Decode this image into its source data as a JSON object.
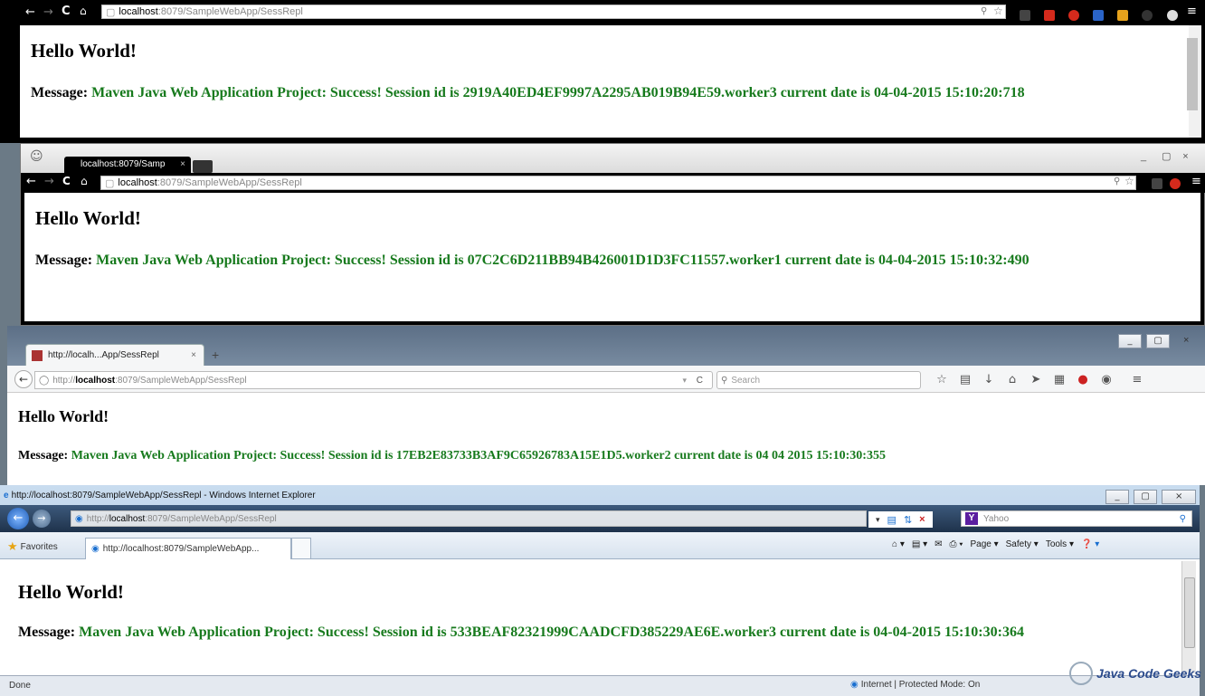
{
  "win1": {
    "url_host": "localhost",
    "url_rest": ":8079/SampleWebApp/SessRepl",
    "heading": "Hello World!",
    "msg_label": "Message:",
    "msg_text": "Maven Java Web Application Project: Success! Session id is 2919A40ED4EF9997A2295AB019B94E59.worker3 current date is 04-04-2015 15:10:20:718"
  },
  "win2": {
    "tab_title": "localhost:8079/Samp",
    "url_host": "localhost",
    "url_rest": ":8079/SampleWebApp/SessRepl",
    "heading": "Hello World!",
    "msg_label": "Message:",
    "msg_text": "Maven Java Web Application Project: Success! Session id is 07C2C6D211BB94B426001D1D3FC11557.worker1 current date is 04-04-2015 15:10:32:490"
  },
  "win3": {
    "tab_title": "http://localh...App/SessRepl",
    "url_prefix": "http://",
    "url_host": "localhost",
    "url_rest": ":8079/SampleWebApp/SessRepl",
    "search_placeholder": "Search",
    "heading": "Hello World!",
    "msg_label": "Message:",
    "msg_text": "Maven Java Web Application Project: Success! Session id is 17EB2E83733B3AF9C65926783A15E1D5.worker2 current date is 04 04 2015 15:10:30:355"
  },
  "win4": {
    "title": "http://localhost:8079/SampleWebApp/SessRepl - Windows Internet Explorer",
    "url_prefix": "http://",
    "url_host": "localhost",
    "url_rest": ":8079/SampleWebApp/SessRepl",
    "search_text": "Yahoo",
    "favorites_label": "Favorites",
    "tab_title": "http://localhost:8079/SampleWebApp...",
    "cmd_page": "Page",
    "cmd_safety": "Safety",
    "cmd_tools": "Tools",
    "heading": "Hello World!",
    "msg_label": "Message:",
    "msg_text": "Maven Java Web Application Project: Success! Session id is 533BEAF82321999CAADCFD385229AE6E.worker3 current date is 04-04-2015 15:10:30:364",
    "status_left": "Done",
    "status_zone": "Internet | Protected Mode: On"
  },
  "watermark": "Java Code Geeks",
  "colors": {
    "green": "#177a1d",
    "chrome_dark": "#000000"
  }
}
